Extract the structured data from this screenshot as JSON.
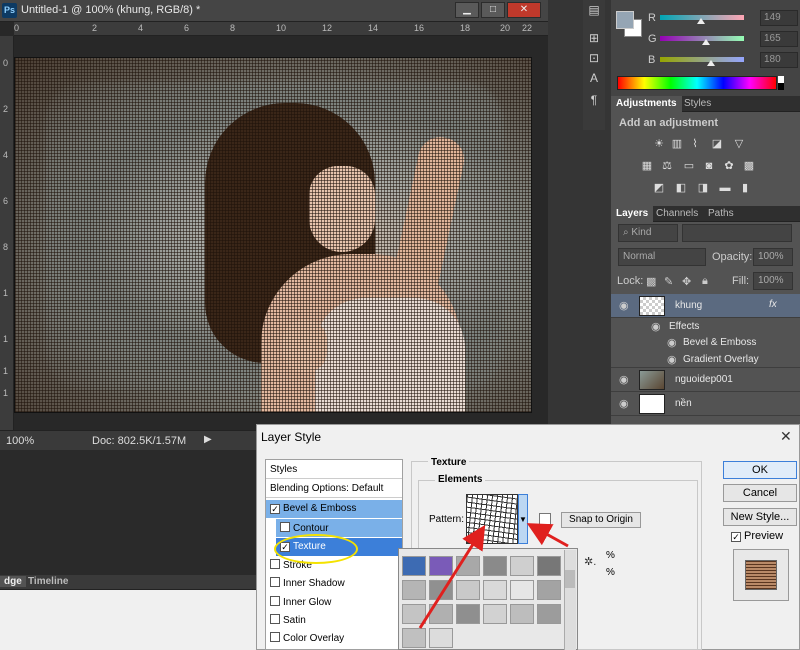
{
  "document": {
    "app_icon": "Ps",
    "title": "Untitled-1 @ 100% (khung, RGB/8) *",
    "window_buttons": [
      "▁",
      "□",
      "✕"
    ],
    "ruler_top_ticks": [
      "0",
      "2",
      "4",
      "6",
      "8",
      "10",
      "12",
      "14",
      "16",
      "18",
      "20",
      "22"
    ],
    "ruler_left_ticks": [
      "0",
      "2",
      "4",
      "6",
      "8",
      "1",
      "1",
      "1",
      "1"
    ],
    "status_zoom": "100%",
    "status_doc": "Doc: 802.5K/1.57M",
    "status_arrow": "▶"
  },
  "color_panel": {
    "fg_color": "#95a5b4",
    "channels": [
      {
        "label": "R",
        "value": "149"
      },
      {
        "label": "G",
        "value": "165"
      },
      {
        "label": "B",
        "value": "180"
      }
    ]
  },
  "adjustments": {
    "tabs": [
      "Adjustments",
      "Styles"
    ],
    "title": "Add an adjustment",
    "icons": [
      "brightness-icon",
      "levels-icon",
      "curves-icon",
      "exposure-icon",
      "triangle-icon",
      "vibrance-icon",
      "hue-icon",
      "balance-icon",
      "bw-icon",
      "photo-filter-icon",
      "channel-mixer-icon",
      "lookup-icon",
      "invert-icon",
      "posterize-icon",
      "threshold-icon",
      "gradient-map-icon",
      "selective-color-icon"
    ]
  },
  "layers": {
    "tabs": [
      "Layers",
      "Channels",
      "Paths"
    ],
    "kind": "Kind",
    "blend_mode": "Normal",
    "opacity_label": "Opacity:",
    "opacity_value": "100%",
    "lock_label": "Lock:",
    "fill_label": "Fill:",
    "fill_value": "100%",
    "items": [
      {
        "name": "khung",
        "fx": "fx"
      },
      {
        "name": "Effects"
      },
      {
        "name": "Bevel & Emboss"
      },
      {
        "name": "Gradient Overlay"
      },
      {
        "name": "nguoidep001"
      },
      {
        "name": "nền"
      }
    ]
  },
  "bottom_left": {
    "tabs": [
      "dge",
      "Timeline"
    ]
  },
  "dialog": {
    "title": "Layer Style",
    "close": "✕",
    "styles": [
      {
        "label": "Styles",
        "checkbox": false
      },
      {
        "label": "Blending Options: Default",
        "checkbox": false
      },
      {
        "label": "Bevel & Emboss",
        "checkbox": true,
        "checked": true
      },
      {
        "label": "Contour",
        "checkbox": true,
        "checked": false
      },
      {
        "label": "Texture",
        "checkbox": true,
        "checked": true
      },
      {
        "label": "Stroke",
        "checkbox": true,
        "checked": false
      },
      {
        "label": "Inner Shadow",
        "checkbox": true,
        "checked": false
      },
      {
        "label": "Inner Glow",
        "checkbox": true,
        "checked": false
      },
      {
        "label": "Satin",
        "checkbox": true,
        "checked": false
      },
      {
        "label": "Color Overlay",
        "checkbox": true,
        "checked": false
      }
    ],
    "texture_heading": "Texture",
    "elements_heading": "Elements",
    "pattern_label": "Pattern:",
    "snap_button": "Snap to Origin",
    "percent_1": "%",
    "percent_2": "%",
    "buttons": {
      "ok": "OK",
      "cancel": "Cancel",
      "new_style": "New Style..."
    },
    "preview_label": "Preview",
    "preview_checked": true
  },
  "picker_colors": [
    "#3d6bb3",
    "#7a5bb8",
    "#a8a8a8",
    "#8a8a8a",
    "#cfcfcf",
    "#777777",
    "#b5b5b5",
    "#909090",
    "#c9c9c9",
    "#d9d9d9",
    "#e6e6e6",
    "#a3a3a3",
    "#c4c4c4",
    "#b0b0b0",
    "#8f8f8f",
    "#d2d2d2",
    "#bdbdbd",
    "#9c9c9c",
    "#c0c0c0",
    "#dcdcdc"
  ]
}
